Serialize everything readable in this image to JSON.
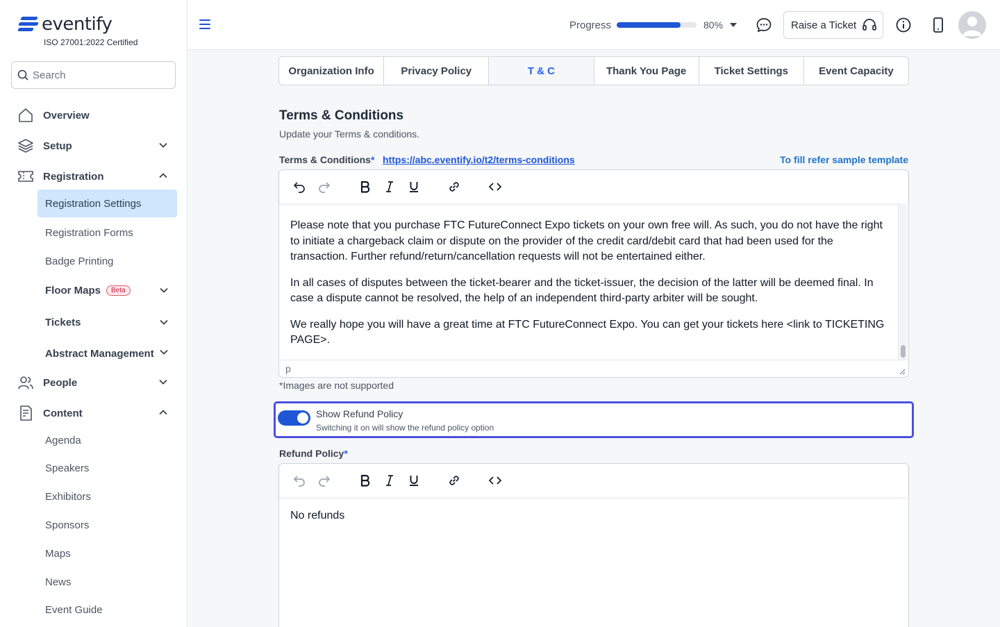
{
  "brand": {
    "name": "eventify",
    "certification": "ISO 27001:2022 Certified"
  },
  "search": {
    "placeholder": "Search"
  },
  "nav": {
    "overview": "Overview",
    "setup": "Setup",
    "registration": "Registration",
    "registration_items": [
      "Registration Settings",
      "Registration Forms",
      "Badge Printing",
      "Floor Maps",
      "Tickets",
      "Abstract Management"
    ],
    "beta_badge": "Beta",
    "people": "People",
    "content": "Content",
    "content_items": [
      "Agenda",
      "Speakers",
      "Exhibitors",
      "Sponsors",
      "Maps",
      "News",
      "Event Guide"
    ]
  },
  "header": {
    "progress_label": "Progress",
    "progress_percent": 80,
    "progress_text": "80%",
    "raise_ticket": "Raise a Ticket"
  },
  "tabs": [
    "Organization Info",
    "Privacy Policy",
    "T & C",
    "Thank You Page",
    "Ticket Settings",
    "Event Capacity"
  ],
  "active_tab": "T & C",
  "section": {
    "title": "Terms & Conditions",
    "subtitle": "Update your Terms & conditions."
  },
  "terms_field": {
    "label": "Terms & Conditions",
    "required_mark": "*",
    "link": "https://abc.eventify.io/t2/terms-conditions",
    "sample_link": "To fill refer sample template",
    "paragraphs": [
      "Please note that you purchase FTC FutureConnect Expo tickets on your own free will. As such, you do not have the right to initiate a chargeback claim or dispute on the provider of the credit card/debit card that had been used for the transaction. Further refund/return/cancellation requests will not be entertained either.",
      "In all cases of disputes between the ticket-bearer and the ticket-issuer, the decision of the latter will be deemed final. In case a dispute cannot be resolved, the help of an independent third-party arbiter will be sought.",
      "We really hope you will have a great time at FTC FutureConnect Expo. You can get your tickets here <link to TICKETING PAGE>."
    ],
    "status_path": "p",
    "note": "*Images are not supported"
  },
  "refund_toggle": {
    "title": "Show Refund Policy",
    "description": "Switching it on will show the refund policy option",
    "enabled": true
  },
  "refund_field": {
    "label": "Refund Policy",
    "required_mark": "*",
    "content": "No refunds"
  },
  "colors": {
    "accent": "#1e56d6",
    "active_bg": "#cfe6fc",
    "focus_border": "#4b4fe0",
    "beta": "#c81e3a"
  }
}
